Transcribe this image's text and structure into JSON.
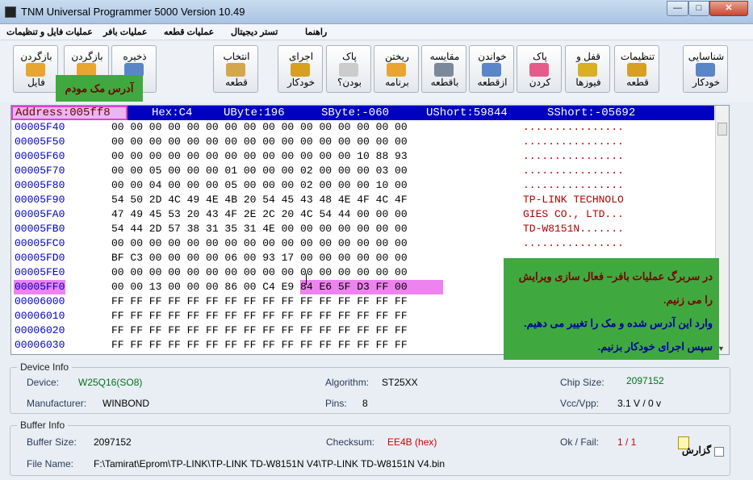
{
  "window": {
    "title": "TNM  Universal Programmer 5000   Version 10.49",
    "controls": {
      "minimize": "—",
      "maximize": "□",
      "close": "✕"
    }
  },
  "menu": [
    {
      "label": "راهنما"
    },
    {
      "label": "تستر دیجیتال"
    },
    {
      "label": "عملیات قطعه"
    },
    {
      "label": "عملیات بافر"
    },
    {
      "label": "عملیات فایل و تنظیمات"
    }
  ],
  "toolbar": [
    {
      "line1": "بازگردن",
      "line2": "فایل",
      "icon": "open-file-icon",
      "color": "#e8a530"
    },
    {
      "line1": "بازگردن",
      "line2": "",
      "icon": "open-buffer-icon",
      "color": "#e8a530"
    },
    {
      "line1": "ذخیره",
      "line2": "",
      "icon": "save-icon",
      "color": "#5a86c8"
    },
    {
      "line1": "انتخاب",
      "line2": "قطعه",
      "icon": "select-chip-icon",
      "color": "#d4a84a"
    },
    {
      "line1": "اجرای",
      "line2": "خودکار",
      "icon": "auto-run-icon",
      "color": "#d8a020"
    },
    {
      "line1": "پاک",
      "line2": "بودن؟",
      "icon": "blank-check-icon",
      "color": "#cccccc"
    },
    {
      "line1": "ریختن",
      "line2": "برنامه",
      "icon": "program-icon",
      "color": "#e8a530"
    },
    {
      "line1": "مقایسه",
      "line2": "باقطعه",
      "icon": "compare-icon",
      "color": "#7a8a9a"
    },
    {
      "line1": "خواندن",
      "line2": "ازقطعه",
      "icon": "read-chip-icon",
      "color": "#5a86c8"
    },
    {
      "line1": "پاک",
      "line2": "کردن",
      "icon": "erase-icon",
      "color": "#e85a8a"
    },
    {
      "line1": "قفل و",
      "line2": "فیوزها",
      "icon": "lock-fuses-icon",
      "color": "#d8b020"
    },
    {
      "line1": "تنظیمات",
      "line2": "قطعه",
      "icon": "chip-settings-icon",
      "color": "#d8a020"
    },
    {
      "line1": "شناسایی",
      "line2": "خودکار",
      "icon": "auto-detect-icon",
      "color": "#5a86c8"
    }
  ],
  "overlays": {
    "mac_label": "آدرس مک مودم",
    "note_lines": [
      "در سربرگ عملیات بافر– فعال سازی ویرایش",
      "را می زنیم.",
      "وارد این آدرس شده و مک را تغییر می دهیم.",
      "سپس اجرای خودکار بزنیم."
    ]
  },
  "hexbar": {
    "address": "Address:005ff8",
    "hex": "Hex:C4",
    "ubyte": "UByte:196",
    "sbyte": "SByte:-060",
    "ushort": "UShort:59844",
    "sshort": "SShort:-05692"
  },
  "hex_rows": [
    {
      "addr": "00005F40",
      "hex": "00 00 00 00 00 00 00 00 00 00 00 00 00 00 00 00",
      "ascii": "................"
    },
    {
      "addr": "00005F50",
      "hex": "00 00 00 00 00 00 00 00 00 00 00 00 00 00 00 00",
      "ascii": "................"
    },
    {
      "addr": "00005F60",
      "hex": "00 00 00 00 00 00 00 00 00 00 00 00 00 10 88 93",
      "ascii": "................"
    },
    {
      "addr": "00005F70",
      "hex": "00 00 05 00 00 00 01 00 00 00 02 00 00 00 03 00",
      "ascii": "................"
    },
    {
      "addr": "00005F80",
      "hex": "00 00 04 00 00 00 05 00 00 00 02 00 00 00 10 00",
      "ascii": "................"
    },
    {
      "addr": "00005F90",
      "hex": "54 50 2D 4C 49 4E 4B 20 54 45 43 48 4E 4F 4C 4F",
      "ascii": "TP-LINK TECHNOLO"
    },
    {
      "addr": "00005FA0",
      "hex": "47 49 45 53 20 43 4F 2E 2C 20 4C 54 44 00 00 00",
      "ascii": "GIES CO., LTD..."
    },
    {
      "addr": "00005FB0",
      "hex": "54 44 2D 57 38 31 35 31 4E 00 00 00 00 00 00 00",
      "ascii": "TD-W8151N......."
    },
    {
      "addr": "00005FC0",
      "hex": "00 00 00 00 00 00 00 00 00 00 00 00 00 00 00 00",
      "ascii": "................"
    },
    {
      "addr": "00005FD0",
      "hex": "BF C3 00 00 00 00 06 00 93 17 00 00 00 00 00 00",
      "ascii": "................"
    },
    {
      "addr": "00005FE0",
      "hex": "00 00 00 00 00 00 00 00 00 00 00 00 00 00 00 00",
      "ascii": "................"
    },
    {
      "addr": "00005FF0",
      "hex": "00 00 13 00 00 00 86 00 C4 E9 84 E6 5F D3 FF 00",
      "ascii": "................"
    },
    {
      "addr": "00006000",
      "hex": "FF FF FF FF FF FF FF FF FF FF FF FF FF FF FF FF",
      "ascii": "................"
    },
    {
      "addr": "00006010",
      "hex": "FF FF FF FF FF FF FF FF FF FF FF FF FF FF FF FF",
      "ascii": "................"
    },
    {
      "addr": "00006020",
      "hex": "FF FF FF FF FF FF FF FF FF FF FF FF FF FF FF FF",
      "ascii": "................"
    },
    {
      "addr": "00006030",
      "hex": "FF FF FF FF FF FF FF FF FF FF FF FF FF FF FF FF",
      "ascii": "................"
    }
  ],
  "device_info": {
    "legend": "Device Info",
    "device_label": "Device:",
    "device": "W25Q16(SO8)",
    "algorithm_label": "Algorithm:",
    "algorithm": "ST25XX",
    "chip_size_label": "Chip Size:",
    "chip_size": "2097152",
    "manufacturer_label": "Manufacturer:",
    "manufacturer": "WINBOND",
    "pins_label": "Pins:",
    "pins": "8",
    "vcc_label": "Vcc/Vpp:",
    "vcc": "3.1 V / 0 v"
  },
  "buffer_info": {
    "legend": "Buffer Info",
    "size_label": "Buffer Size:",
    "size": "2097152",
    "checksum_label": "Checksum:",
    "checksum": "EE4B (hex)",
    "okfail_label": "Ok / Fail:",
    "okfail": "1 / 1",
    "file_label": "File Name:",
    "file": "F:\\Tamirat\\Eprom\\TP-LINK\\TP-LINK TD-W8151N V4\\TP-LINK TD-W8151N V4.bin",
    "report_label": "گزارش"
  }
}
